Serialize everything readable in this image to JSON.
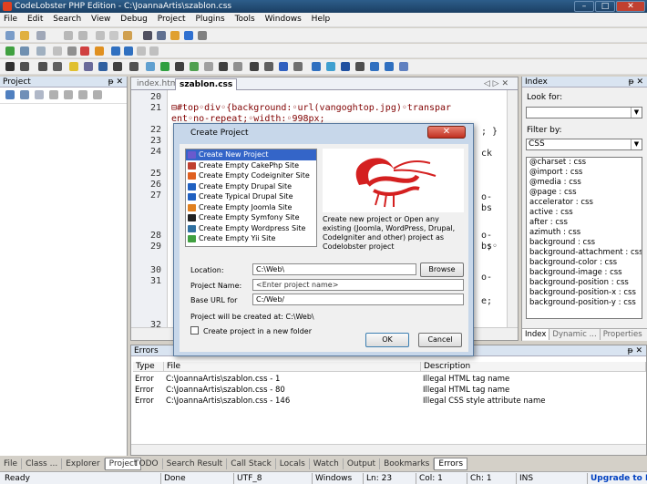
{
  "window": {
    "title": "CodeLobster PHP Edition - C:\\JoannaArtis\\szablon.css",
    "minimize": "–",
    "maximize": "□",
    "close": "✕"
  },
  "menu": [
    "File",
    "Edit",
    "Search",
    "View",
    "Debug",
    "Project",
    "Plugins",
    "Tools",
    "Windows",
    "Help"
  ],
  "left_panel": {
    "title": "Project",
    "pin": "ᵽ ✕"
  },
  "editor": {
    "tabs": [
      "index.htm",
      "szablon.css"
    ],
    "nav": "◁ ▷ ✕",
    "lines": [
      {
        "n": "20",
        "t": ""
      },
      {
        "n": "21",
        "t": "⊟#top◦div◦{background:◦url(vangoghtop.jpg)◦transpar"
      },
      {
        "n": "",
        "t": " ent◦no-repeat;◦width:◦998px;"
      },
      {
        "n": "22",
        "t": ""
      },
      {
        "n": "23",
        "t": ""
      },
      {
        "n": "24",
        "t": ""
      },
      {
        "n": "25",
        "t": ""
      },
      {
        "n": "26",
        "t": ""
      },
      {
        "n": "27",
        "t": ""
      },
      {
        "n": "28",
        "t": ""
      },
      {
        "n": "29",
        "t": ""
      },
      {
        "n": "30",
        "t": ""
      },
      {
        "n": "31",
        "t": ""
      },
      {
        "n": "32",
        "t": ""
      }
    ],
    "right_fragments": [
      "; }",
      "ck",
      "o-",
      "bs",
      "o-",
      "bs",
      ";◦",
      "o-",
      "e;"
    ]
  },
  "right_panel": {
    "title": "Index",
    "pin": "ᵽ ✕",
    "look_for_label": "Look for:",
    "look_for_value": "",
    "filter_label": "Filter by:",
    "filter_value": "CSS",
    "items": [
      "@charset : css",
      "@import : css",
      "@media : css",
      "@page : css",
      "accelerator : css",
      "active : css",
      "after : css",
      "azimuth : css",
      "background : css",
      "background-attachment : css",
      "background-color : css",
      "background-image : css",
      "background-position : css",
      "background-position-x : css",
      "background-position-y : css"
    ],
    "tabs": [
      "Index",
      "Dynamic ...",
      "Properties"
    ]
  },
  "errors": {
    "title": "Errors",
    "pin": "ᵽ ✕",
    "columns": [
      "Type",
      "File",
      "Description"
    ],
    "rows": [
      {
        "type": "Error",
        "file": "C:\\JoannaArtis\\szablon.css - 1",
        "desc": "Illegal HTML tag name"
      },
      {
        "type": "Error",
        "file": "C:\\JoannaArtis\\szablon.css - 80",
        "desc": "Illegal HTML tag name"
      },
      {
        "type": "Error",
        "file": "C:\\JoannaArtis\\szablon.css - 146",
        "desc": "Illegal CSS style attribute name"
      }
    ]
  },
  "left_tabs": [
    "File",
    "Class ...",
    "Explorer",
    "Project"
  ],
  "bottom_tabs": [
    "TODO",
    "Search Result",
    "Call Stack",
    "Locals",
    "Watch",
    "Output",
    "Bookmarks",
    "Errors"
  ],
  "status": {
    "ready": "Ready",
    "done": "Done",
    "encoding": "UTF_8",
    "lineend": "Windows",
    "ln": "Ln: 23",
    "col": "Col: 1",
    "ch": "Ch: 1",
    "ins": "INS",
    "upgrade": "Upgrade to Pl"
  },
  "dialog": {
    "title": "Create Project",
    "close": "✕",
    "projects": [
      {
        "label": "Create New Project",
        "color": "#6a5acd"
      },
      {
        "label": "Create Empty CakePhp Site",
        "color": "#c04030"
      },
      {
        "label": "Create Empty Codeigniter Site",
        "color": "#e06020"
      },
      {
        "label": "Create Empty Drupal Site",
        "color": "#2060c0"
      },
      {
        "label": "Create Typical Drupal Site",
        "color": "#2060c0"
      },
      {
        "label": "Create Empty Joomla Site",
        "color": "#e08020"
      },
      {
        "label": "Create Empty Symfony Site",
        "color": "#222222"
      },
      {
        "label": "Create Empty Wordpress Site",
        "color": "#3070a0"
      },
      {
        "label": "Create Empty Yii Site",
        "color": "#40a040"
      }
    ],
    "description": "Create new project or Open any existing (Joomla, WordPress, Drupal, CodeIgniter and other) project as Codelobster project",
    "location_label": "Location:",
    "location_value": "C:\\Web\\",
    "browse": "Browse",
    "name_label": "Project Name:",
    "name_placeholder": "<Enter project name>",
    "base_label": "Base URL for",
    "base_value": "C:/Web/",
    "created_at": "Project will be created at:  C:\\Web\\",
    "checkbox_label": "Create project in a new folder",
    "ok": "OK",
    "cancel": "Cancel"
  }
}
